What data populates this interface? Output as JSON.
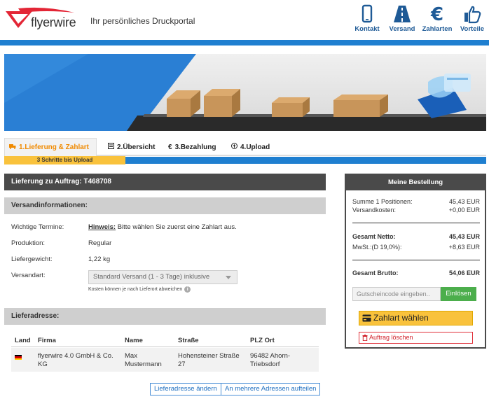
{
  "header": {
    "brand": "flyerwire",
    "tagline": "Ihr persönliches Druckportal",
    "nav": [
      {
        "label": "Kontakt",
        "icon": "phone-icon"
      },
      {
        "label": "Versand",
        "icon": "road-icon"
      },
      {
        "label": "Zahlarten",
        "icon": "euro-icon"
      },
      {
        "label": "Vorteile",
        "icon": "thumbs-up-icon"
      }
    ]
  },
  "tabs": [
    {
      "label": "1.Lieferung & Zahlart",
      "icon": "truck-icon",
      "active": true
    },
    {
      "label": "2.Übersicht",
      "icon": "list-icon"
    },
    {
      "label": "3.Bezahlung",
      "icon": "euro-icon"
    },
    {
      "label": "4.Upload",
      "icon": "upload-icon"
    }
  ],
  "steps_note": "3 Schritte bis Upload",
  "delivery": {
    "title": "Lieferung zu Auftrag: T468708",
    "shipping_section": "Versandinformationen:",
    "fields": [
      {
        "label": "Wichtige Termine:",
        "hint": "Hinweis:",
        "value": " Bitte wählen Sie zuerst eine Zahlart aus."
      },
      {
        "label": "Produktion:",
        "value": "Regular"
      },
      {
        "label": "Liefergewicht:",
        "value": "1,22 kg"
      },
      {
        "label": "Versandart:",
        "value": ""
      }
    ],
    "shipping_select": "Standard Versand (1 - 3 Tage) inklusive",
    "shipping_note": "Kosten können je nach Lieferort abweichen",
    "address_section": "Lieferadresse:",
    "address_columns": [
      "Land",
      "Firma",
      "Name",
      "Straße",
      "PLZ Ort"
    ],
    "address_row": {
      "company_1": "flyerwire 4.0 GmbH & Co.",
      "company_2": "KG",
      "name_1": "Max",
      "name_2": "Mustermann",
      "street_1": "Hohensteiner Straße",
      "street_2": "27",
      "city_1": "96482 Ahorn-",
      "city_2": "Triebsdorf"
    },
    "change_address": "Lieferadresse ändern",
    "split_address": "An mehrere Adressen aufteilen"
  },
  "order": {
    "title": "Meine Bestellung",
    "sum_label": "Summe 1 Positionen:",
    "sum_value": "45,43 EUR",
    "shipping_label": "Versandkosten:",
    "shipping_value": "+0,00 EUR",
    "net_label": "Gesamt Netto:",
    "net_value": "45,43 EUR",
    "vat_label": "MwSt.:(D 19,0%):",
    "vat_value": "+8,63 EUR",
    "gross_label": "Gesamt Brutto:",
    "gross_value": "54,06 EUR",
    "voucher_placeholder": "Gutscheincode eingeben..",
    "redeem": "Einlösen",
    "choose_payment": "Zahlart wählen",
    "delete_order": "Auftrag löschen"
  },
  "colors": {
    "brand_red": "#e32636",
    "nav_blue": "#1e5a96",
    "accent_blue": "#1f7fd0",
    "active_orange": "#f08a00",
    "yellow": "#f9c23c",
    "green": "#4cae4c"
  }
}
